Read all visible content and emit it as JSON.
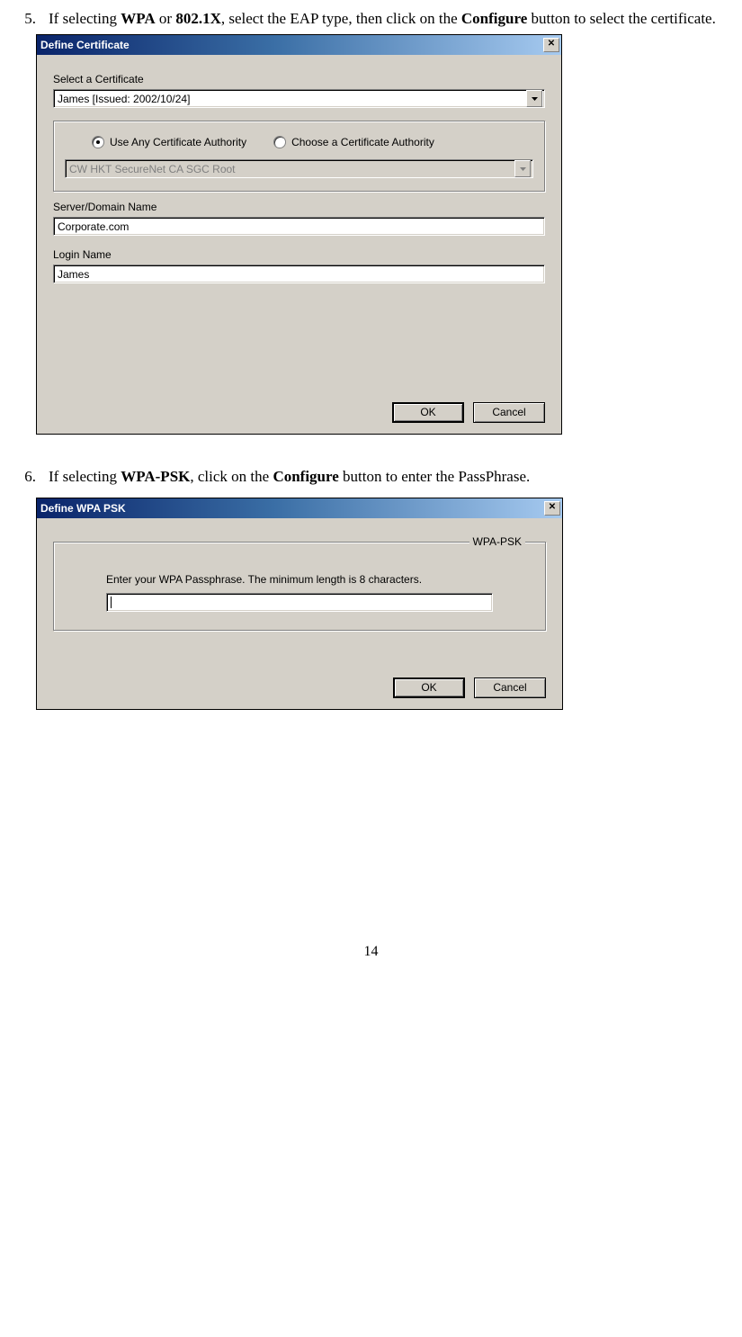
{
  "step5": {
    "number": "5.",
    "text_pre": "If selecting ",
    "wpa": "WPA",
    "or": " or ",
    "x8021": "802.1X",
    "text_mid": ", select the EAP type, then click on the ",
    "configure": "Configure",
    "text_post": " button to select the certificate."
  },
  "dlg_cert": {
    "title": "Define Certificate",
    "select_label": "Select a Certificate",
    "cert_value": "James   [Issued: 2002/10/24]",
    "radio_any": "Use Any Certificate Authority",
    "radio_choose": "Choose a Certificate Authority",
    "ca_value": "CW HKT SecureNet CA SGC Root",
    "server_label": "Server/Domain Name",
    "server_value": "Corporate.com",
    "login_label": "Login Name",
    "login_value": "James",
    "ok": "OK",
    "cancel": "Cancel"
  },
  "step6": {
    "number": "6.",
    "text_pre": "If selecting ",
    "wpapsk": "WPA-PSK",
    "text_mid": ", click on the ",
    "configure": "Configure",
    "text_post": " button to enter the PassPhrase."
  },
  "dlg_psk": {
    "title": "Define WPA PSK",
    "legend": "WPA-PSK",
    "prompt": "Enter your WPA Passphrase.  The minimum length is 8 characters.",
    "value": "",
    "ok": "OK",
    "cancel": "Cancel"
  },
  "page_number": "14"
}
